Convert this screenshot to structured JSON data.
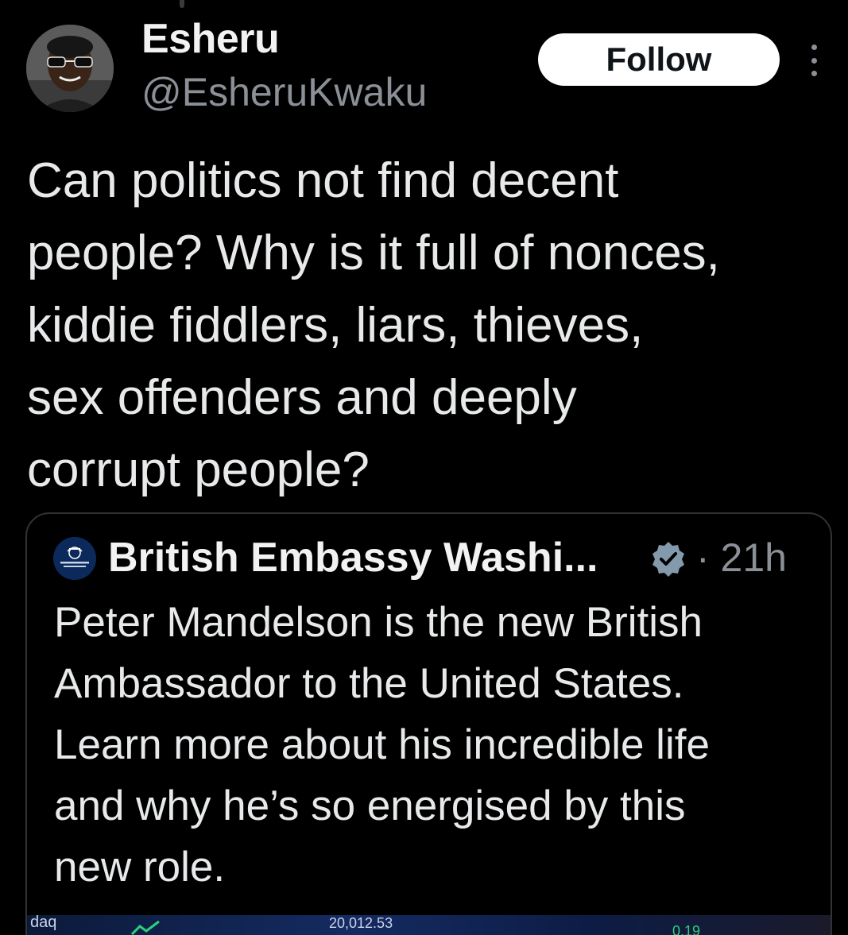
{
  "tweet": {
    "author": {
      "name": "Esheru",
      "handle": "@EsheruKwaku",
      "avatar_icon": "user-avatar"
    },
    "follow_label": "Follow",
    "more_icon": "more-dots-icon",
    "text": "Can politics not find decent\npeople? Why is it full of nonces,\nkiddie fiddlers, liars, thieves,\nsex offenders and deeply\ncorrupt people?"
  },
  "quoted_tweet": {
    "avatar_icon": "british-embassy-crest",
    "author_name": "British Embassy Washi...",
    "verified_icon": "verified-badge-icon",
    "meta": "· 21h",
    "text": "Peter Mandelson is the new British\nAmbassador to the United States.\nLearn more about his incredible life\nand why he’s so energised by this\nnew role.",
    "media": {
      "label_left": "daq",
      "ticker_value": "20,012.53",
      "ticker_change": "0.19"
    }
  },
  "colors": {
    "background": "#000000",
    "text_primary": "#e7e9ea",
    "text_secondary": "#8b9096",
    "border": "#2f3336",
    "verified": "#829aab"
  }
}
